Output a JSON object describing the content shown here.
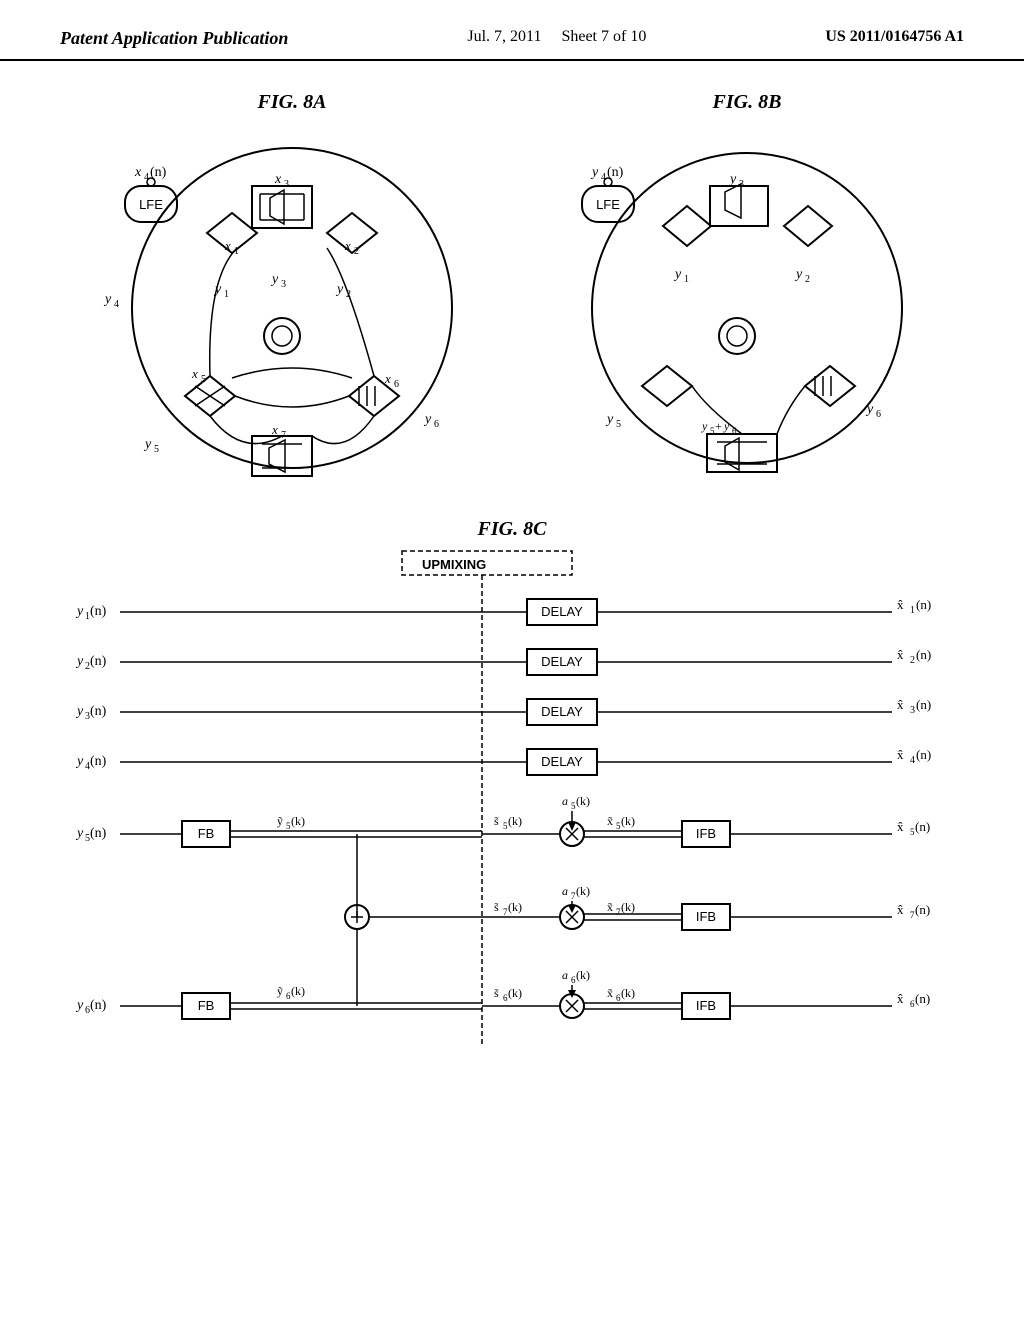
{
  "header": {
    "left": "Patent Application Publication",
    "center_date": "Jul. 7, 2011",
    "center_sheet": "Sheet 7 of 10",
    "right": "US 2011/0164756 A1"
  },
  "figures": {
    "fig8a_label": "FIG. 8A",
    "fig8b_label": "FIG. 8B",
    "fig8c_label": "FIG. 8C"
  }
}
